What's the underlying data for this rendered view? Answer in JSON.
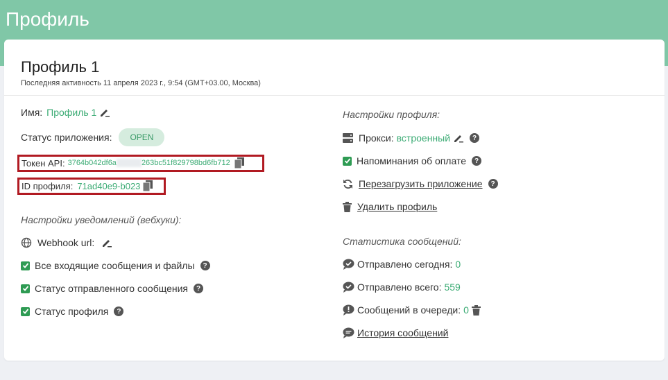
{
  "header": {
    "title": "Профиль"
  },
  "profile": {
    "title": "Профиль 1",
    "last_activity": "Последняя активность 11 апреля 2023 г., 9:54 (GMT+03.00, Москва)"
  },
  "fields": {
    "name_label": "Имя:",
    "name_value": "Профиль 1",
    "app_status_label": "Статус приложения:",
    "app_status_value": "OPEN",
    "token_label": "Токен API:",
    "token_value_start": "3764b042df6a",
    "token_value_end": "263bc51f829798bd6fb712",
    "id_label": "ID профиля:",
    "id_value": "71ad40e9-b023"
  },
  "webhooks": {
    "title": "Настройки уведомлений (вебхуки):",
    "url_label": "Webhook url:",
    "items": [
      {
        "label": "Все входящие сообщения и файлы",
        "checked": true
      },
      {
        "label": "Статус отправленного сообщения",
        "checked": true
      },
      {
        "label": "Статус профиля",
        "checked": true
      }
    ]
  },
  "profile_settings": {
    "title": "Настройки профиля:",
    "proxy_label": "Прокси:",
    "proxy_value": "встроенный",
    "payment_reminder": "Напоминания об оплате",
    "reload_app": "Перезагрузить приложение",
    "delete_profile": "Удалить профиль"
  },
  "stats": {
    "title": "Статистика сообщений:",
    "sent_today_label": "Отправлено сегодня:",
    "sent_today": "0",
    "sent_total_label": "Отправлено всего:",
    "sent_total": "559",
    "queue_label": "Сообщений в очереди:",
    "queue": "0",
    "history": "История сообщений"
  }
}
